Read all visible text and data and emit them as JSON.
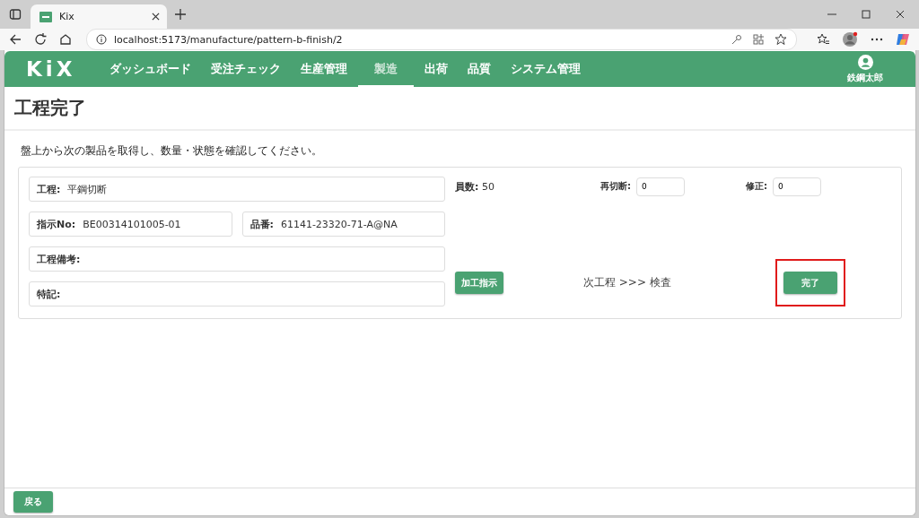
{
  "browser": {
    "tab_title": "Kix",
    "url": "localhost:5173/manufacture/pattern-b-finish/2"
  },
  "app": {
    "logo": "KiX",
    "nav": [
      {
        "label": "ダッシュボード",
        "selected": false
      },
      {
        "label": "受注チェック",
        "selected": false
      },
      {
        "label": "生産管理",
        "selected": false
      },
      {
        "label": "製造",
        "selected": true
      },
      {
        "label": "出荷",
        "selected": false
      },
      {
        "label": "品質",
        "selected": false
      },
      {
        "label": "システム管理",
        "selected": false
      }
    ],
    "user": {
      "name": "鉄鋼太郎"
    }
  },
  "page": {
    "title": "工程完了",
    "instruction": "盤上から次の製品を取得し、数量・状態を確認してください。",
    "field_rows": [
      [
        {
          "label": "工程:",
          "value": "平鋼切断"
        }
      ],
      [
        {
          "label": "指示No:",
          "value": "BE00314101005-01"
        },
        {
          "label": "品番:",
          "value": "61141-23320-71-A@NA"
        }
      ],
      [
        {
          "label": "工程備考:"
        }
      ],
      [
        {
          "label": "特記:"
        }
      ]
    ],
    "count": {
      "label": "員数:",
      "value": "50"
    },
    "inputs": [
      {
        "label": "再切断:",
        "value": "0"
      },
      {
        "label": "修正:",
        "value": "0"
      }
    ],
    "process_button": "加工指示",
    "next_process": "次工程 >>> 検査",
    "complete_button": {
      "label": "完了",
      "highlighted": true
    },
    "back_button": "戻る"
  }
}
